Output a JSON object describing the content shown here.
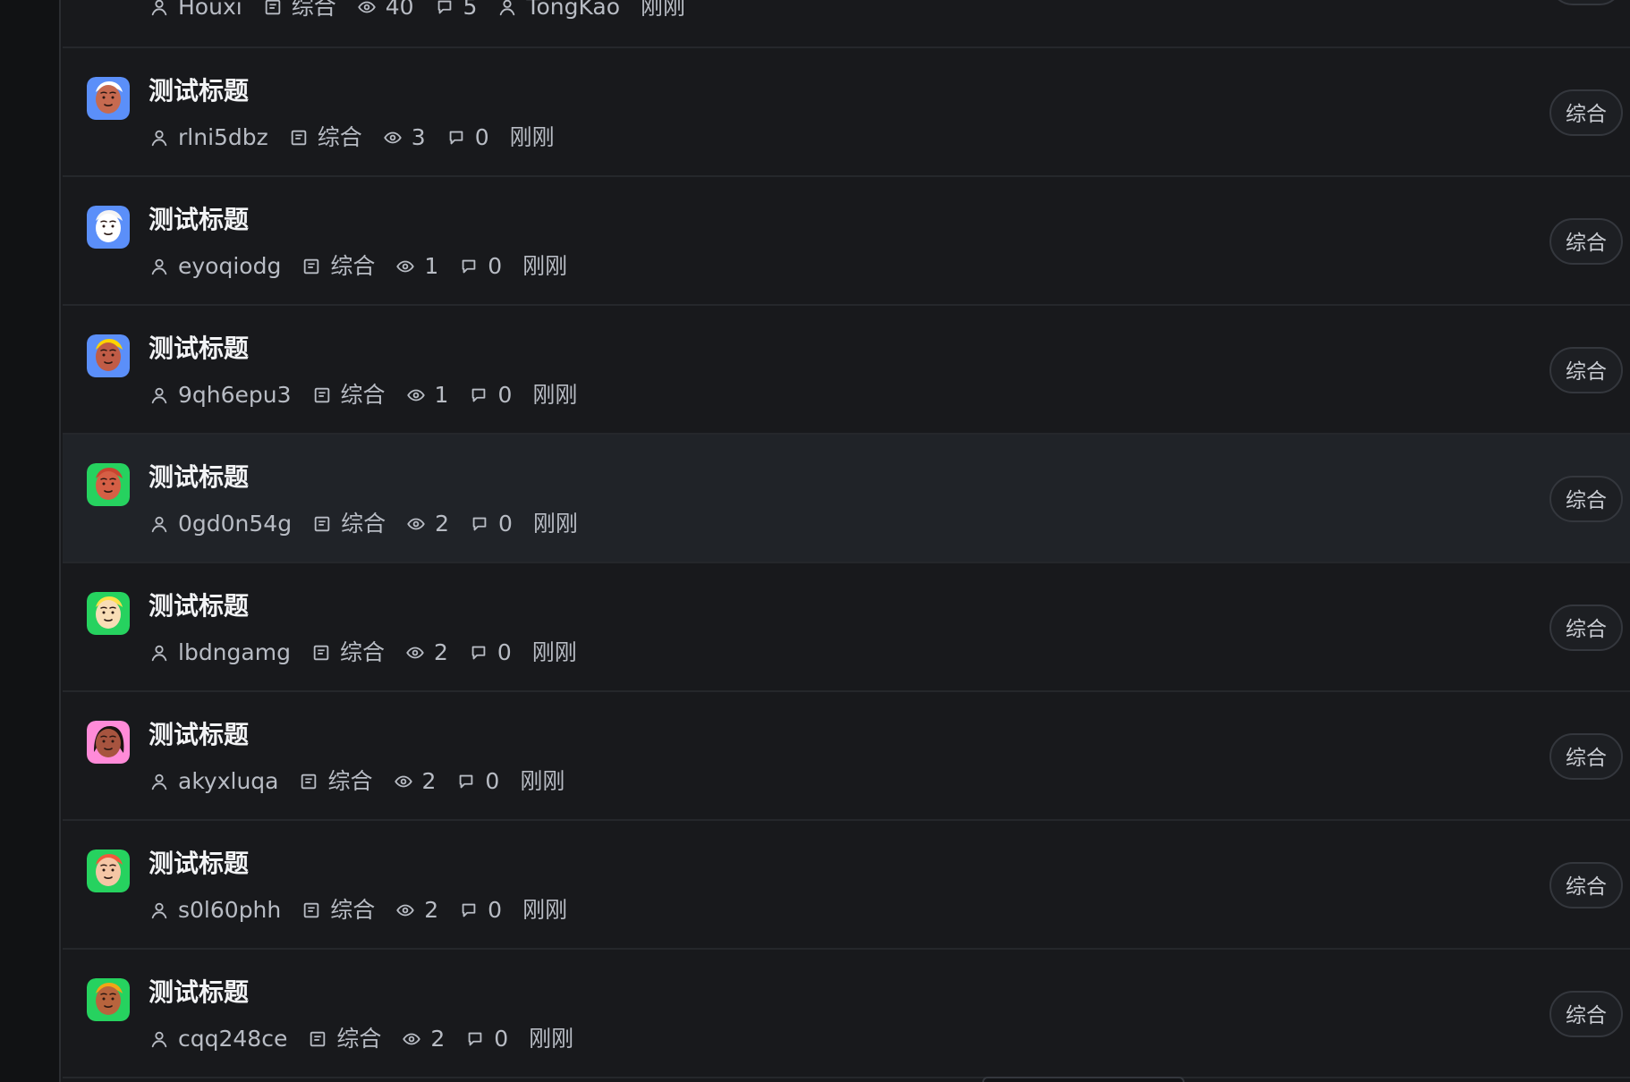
{
  "feed": {
    "top_partial": {
      "author": "Houxi",
      "category": "综合",
      "views": "40",
      "comments": "5",
      "last_reply_user": "TongKao",
      "time": "刚刚",
      "category_button": ""
    },
    "posts": [
      {
        "title": "测试标题",
        "author": "rlni5dbz",
        "category": "综合",
        "views": "3",
        "comments": "0",
        "time": "刚刚",
        "category_button": "综合",
        "avatar_bg": "#5b8ff9",
        "avatar_face": "#c66a50",
        "avatar_hair": "#ffffff"
      },
      {
        "title": "测试标题",
        "author": "eyoqiodg",
        "category": "综合",
        "views": "1",
        "comments": "0",
        "time": "刚刚",
        "category_button": "综合",
        "avatar_bg": "#5b8ff9",
        "avatar_face": "#ffffff",
        "avatar_hair": "#f4f4f4"
      },
      {
        "title": "测试标题",
        "author": "9qh6epu3",
        "category": "综合",
        "views": "1",
        "comments": "0",
        "time": "刚刚",
        "category_button": "综合",
        "avatar_bg": "#5b8ff9",
        "avatar_face": "#c05c46",
        "avatar_hair": "#ffd400"
      },
      {
        "title": "测试标题",
        "author": "0gd0n54g",
        "category": "综合",
        "views": "2",
        "comments": "0",
        "time": "刚刚",
        "category_button": "综合",
        "avatar_bg": "#26d25f",
        "avatar_face": "#d55f45",
        "avatar_hair": "#c94530"
      },
      {
        "title": "测试标题",
        "author": "lbdngamg",
        "category": "综合",
        "views": "2",
        "comments": "0",
        "time": "刚刚",
        "category_button": "综合",
        "avatar_bg": "#26d25f",
        "avatar_face": "#f8ddb6",
        "avatar_hair": "#ffe04a"
      },
      {
        "title": "测试标题",
        "author": "akyxluqa",
        "category": "综合",
        "views": "2",
        "comments": "0",
        "time": "刚刚",
        "category_button": "综合",
        "avatar_bg": "#ff8bd8",
        "avatar_face": "#a7543f",
        "avatar_hair": "#1b1311"
      },
      {
        "title": "测试标题",
        "author": "s0l60phh",
        "category": "综合",
        "views": "2",
        "comments": "0",
        "time": "刚刚",
        "category_button": "综合",
        "avatar_bg": "#26d25f",
        "avatar_face": "#f5c6a5",
        "avatar_hair": "#f05a3c"
      },
      {
        "title": "测试标题",
        "author": "cqq248ce",
        "category": "综合",
        "views": "2",
        "comments": "0",
        "time": "刚刚",
        "category_button": "综合",
        "avatar_bg": "#26d25f",
        "avatar_face": "#b8643d",
        "avatar_hair": "#f2a516"
      }
    ]
  },
  "colors": {
    "background": "#18191c",
    "highlight_row": "#202328",
    "primary_text": "#f2f3f5",
    "secondary_text": "#b8bcc4",
    "divider": "#25272b",
    "button_border": "#34373d"
  },
  "icons": {
    "author": "user-icon",
    "category": "category-icon",
    "views": "eye-icon",
    "comments": "comment-icon",
    "reply_user": "user-icon"
  }
}
